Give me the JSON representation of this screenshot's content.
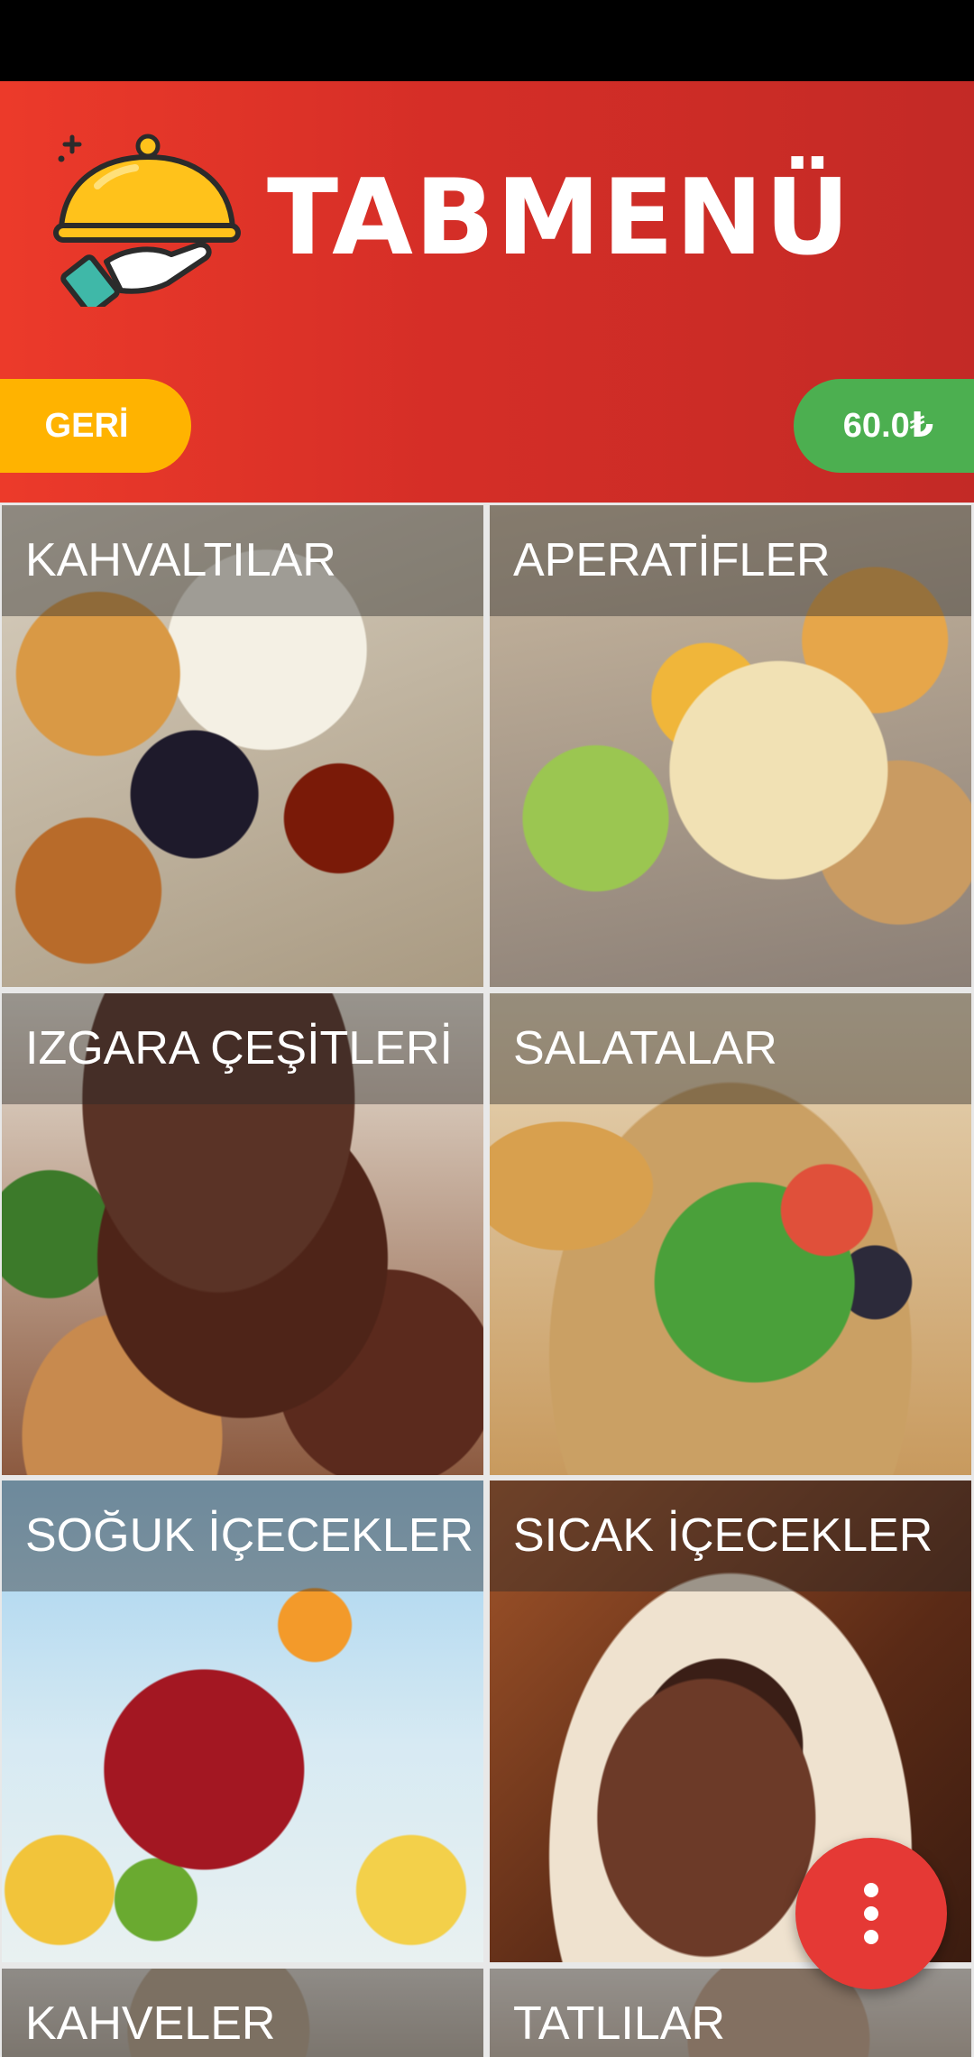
{
  "app": {
    "brand_name": "TABMENÜ",
    "colors": {
      "header": "#d52e27",
      "back_button": "#ffb300",
      "price_badge": "#4caf50",
      "fab": "#e53935"
    }
  },
  "header": {
    "back_label": "GERİ",
    "total_price": "60.0₺",
    "logo_icon": "cloche-on-hand-icon"
  },
  "categories": [
    {
      "label": "KAHVALTILAR"
    },
    {
      "label": "APERATİFLER"
    },
    {
      "label": "IZGARA ÇEŞİTLERİ"
    },
    {
      "label": "SALATALAR"
    },
    {
      "label": "SOĞUK İÇECEKLER"
    },
    {
      "label": "SICAK İÇECEKLER"
    },
    {
      "label": "KAHVELER"
    },
    {
      "label": "TATLILAR"
    }
  ],
  "fab": {
    "icon": "more-vertical-icon"
  }
}
